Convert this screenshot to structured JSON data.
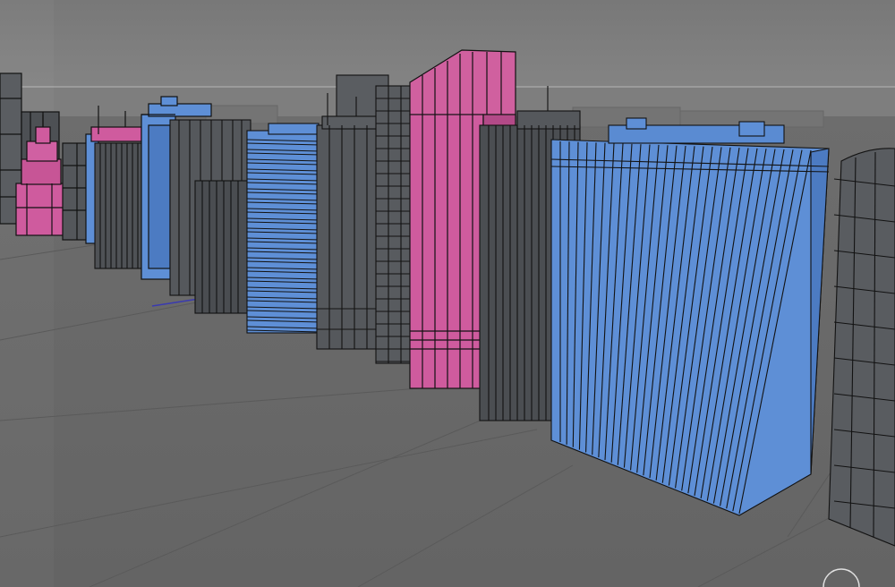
{
  "viewport": {
    "colors": {
      "sky": "#7a7a7a",
      "horizon_band": "#8a8a8a",
      "ground": "#686868",
      "grid_line": "#5c5c5c",
      "axis_x": "#3a3ab0",
      "edge": "#121212",
      "building_grey": "#5a5d61",
      "building_grey_shade": "#484b4f",
      "building_blue": "#5e8fd6",
      "building_blue_shade": "#4c7bc2",
      "building_pink": "#cf5b9e",
      "building_pink_shade": "#b34a88"
    },
    "buildings": [
      {
        "name": "far-left-grey-tower",
        "material": "grey"
      },
      {
        "name": "small-pink-tower",
        "material": "pink"
      },
      {
        "name": "narrow-grey-block",
        "material": "grey"
      },
      {
        "name": "thin-blue-spire",
        "material": "blue"
      },
      {
        "name": "grey-slab-tower",
        "material": "grey"
      },
      {
        "name": "blue-frame-tower",
        "material": "blue"
      },
      {
        "name": "tall-grey-block",
        "material": "grey"
      },
      {
        "name": "short-grey-block",
        "material": "grey"
      },
      {
        "name": "blue-ribbed-tower",
        "material": "blue"
      },
      {
        "name": "grey-stepped-tower",
        "material": "grey"
      },
      {
        "name": "grey-grid-tower",
        "material": "grey"
      },
      {
        "name": "pink-slanted-tower",
        "material": "pink"
      },
      {
        "name": "dark-grey-tower",
        "material": "grey"
      },
      {
        "name": "large-blue-block",
        "material": "blue"
      },
      {
        "name": "right-grey-grid-tower",
        "material": "grey"
      }
    ],
    "nav_control_icon": "orbit-circle-icon"
  }
}
